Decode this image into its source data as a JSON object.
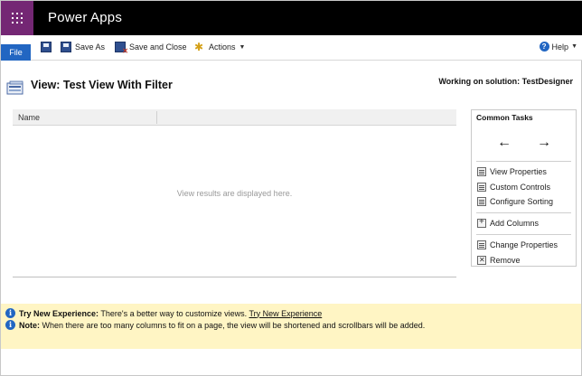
{
  "app": {
    "title": "Power Apps"
  },
  "ribbon": {
    "file_label": "File",
    "save_as_label": "Save As",
    "save_close_label": "Save and Close",
    "actions_label": "Actions",
    "help_label": "Help"
  },
  "page": {
    "title": "View: Test View With Filter",
    "solution": "Working on solution: TestDesigner"
  },
  "grid": {
    "columns": [
      "Name"
    ],
    "empty_message": "View results are displayed here."
  },
  "tasks": {
    "title": "Common Tasks",
    "back_glyph": "←",
    "forward_glyph": "→",
    "items": [
      {
        "label": "View Properties",
        "icon": "view-properties-icon"
      },
      {
        "label": "Custom Controls",
        "icon": "custom-controls-icon"
      },
      {
        "label": "Configure Sorting",
        "icon": "configure-sorting-icon"
      },
      {
        "label": "Add Columns",
        "icon": "add-columns-icon"
      },
      {
        "label": "Change Properties",
        "icon": "change-properties-icon"
      },
      {
        "label": "Remove",
        "icon": "remove-icon"
      }
    ]
  },
  "notifications": [
    {
      "prefix": "Try New Experience:",
      "text": " There's a better way to customize views. ",
      "link": "Try New Experience"
    },
    {
      "prefix": "Note:",
      "text": " When there are too many columns to fit on a page, the view will be shortened and scrollbars will be added."
    }
  ],
  "colors": {
    "brand_purple": "#742774",
    "file_blue": "#2266c2",
    "notification_bg": "#fff5c4"
  }
}
